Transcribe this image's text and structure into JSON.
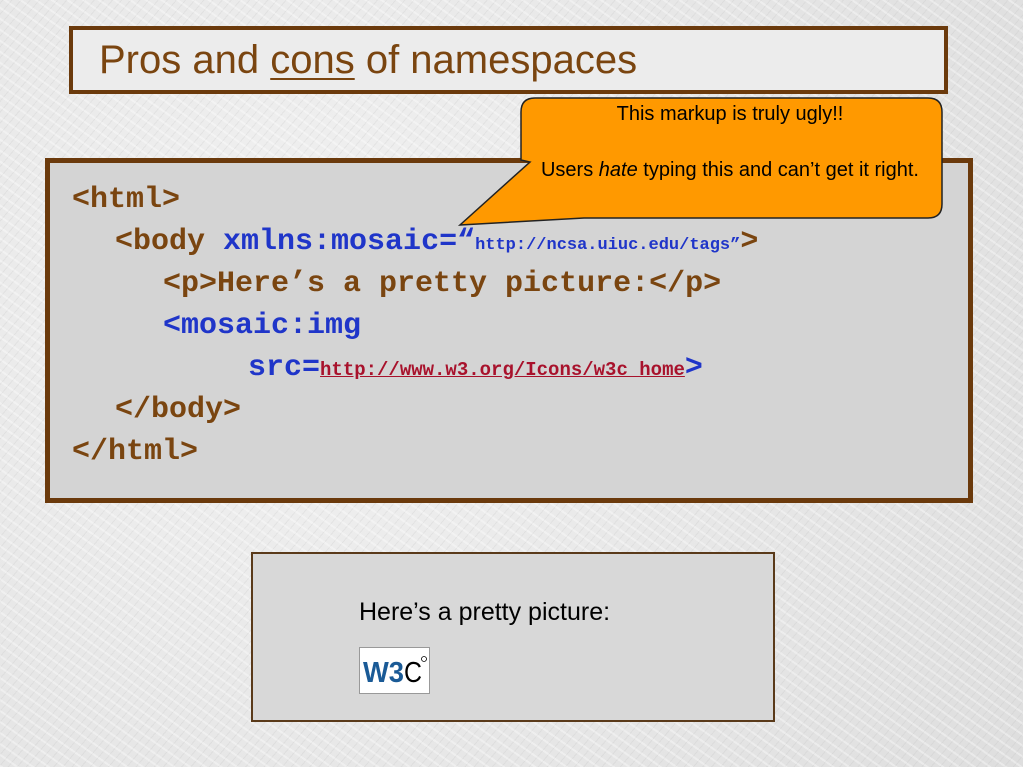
{
  "slide": {
    "title_pre": "Pros and ",
    "title_underlined": "cons",
    "title_post": " of namespaces"
  },
  "callout": {
    "line1": "This markup is truly ugly!!",
    "line2_pre": "Users ",
    "line2_em": "hate",
    "line2_post": " typing this and can’t get it right.",
    "color": "#ff9900"
  },
  "code": {
    "l1": "<html>",
    "l2_tag": "<body ",
    "l2_attr": "xmlns:mosaic=“",
    "l2_url": "http://ncsa.uiuc.edu/tags”",
    "l2_end": ">",
    "l3": "<p>Here’s a pretty picture:</p>",
    "l4": "<mosaic:img",
    "l5_attr": "src=",
    "l5_url": "http://www.w3.org/Icons/w3c_home",
    "l5_end": ">",
    "l6": "</body>",
    "l7": "</html>"
  },
  "rendered": {
    "text": "Here’s a pretty picture:",
    "logo_text": "W3C"
  },
  "colors": {
    "brown": "#7a4510",
    "blue": "#1f35c9",
    "link": "#a8122c",
    "border": "#6b3a0c"
  }
}
